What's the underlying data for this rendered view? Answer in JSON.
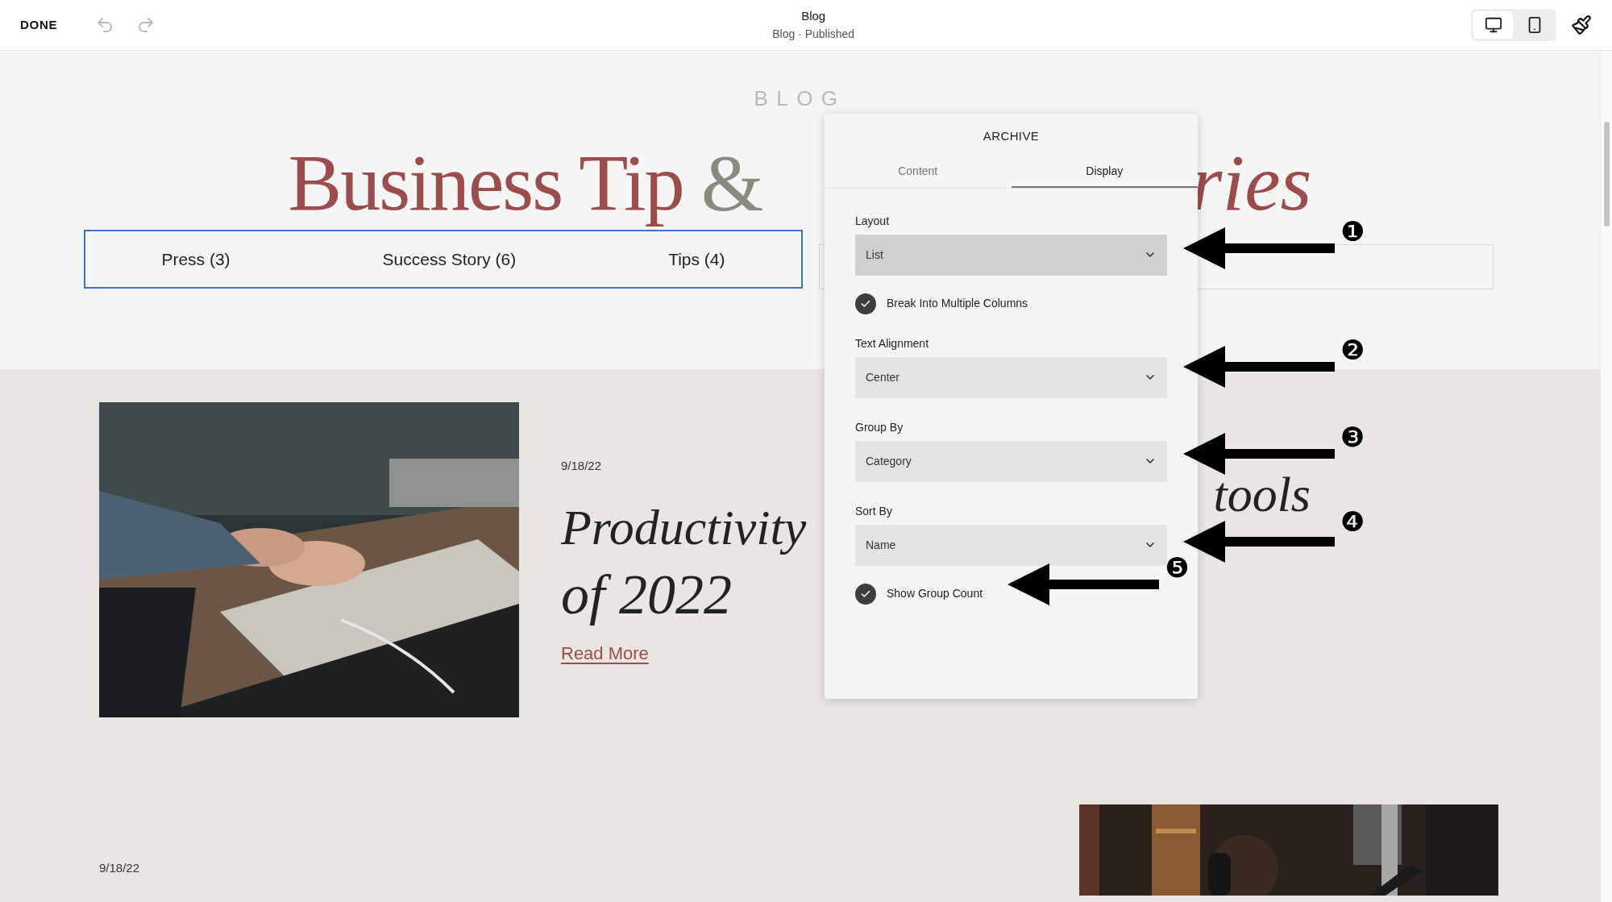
{
  "top_bar": {
    "done": "DONE",
    "undo_disabled": true,
    "redo_disabled": true,
    "title": "Blog",
    "subtitle": "Blog · Published",
    "devices": [
      {
        "kind": "desktop",
        "selected": true
      },
      {
        "kind": "mobile",
        "selected": false
      }
    ]
  },
  "page": {
    "eyebrow": "BLOG",
    "heading_left": "Business Tip",
    "ampersand": "&",
    "heading_right": "ries",
    "category_block": {
      "selected": true,
      "items": [
        {
          "label": "Press (3)"
        },
        {
          "label": "Success Story (6)"
        },
        {
          "label": "Tips (4)"
        }
      ]
    },
    "posts": [
      {
        "kind": "picture-left",
        "date": "9/18/22",
        "title_start": "Productivity",
        "title_end": "tools",
        "title_line2": "of 2022",
        "link": "Read More"
      },
      {
        "kind": "picture-right",
        "date": "9/18/22"
      }
    ]
  },
  "panel": {
    "title": "ARCHIVE",
    "tabs": [
      {
        "label": "Content",
        "selected": false
      },
      {
        "label": "Display",
        "selected": true
      }
    ],
    "controls": [
      {
        "kind": "select",
        "label": "Layout",
        "value": "List",
        "focused": true
      },
      {
        "kind": "checkbox",
        "label": "Break Into Multiple Columns",
        "checked": true
      },
      {
        "kind": "select",
        "label": "Text Alignment",
        "value": "Center",
        "focused": false
      },
      {
        "kind": "select",
        "label": "Group By",
        "value": "Category",
        "focused": false
      },
      {
        "kind": "select",
        "label": "Sort By",
        "value": "Name",
        "focused": false
      },
      {
        "kind": "checkbox",
        "label": "Show Group Count",
        "checked": true
      }
    ]
  },
  "annotations": [
    {
      "number": "❶"
    },
    {
      "number": "❷"
    },
    {
      "number": "❸"
    },
    {
      "number": "❹"
    },
    {
      "number": "❺"
    }
  ]
}
